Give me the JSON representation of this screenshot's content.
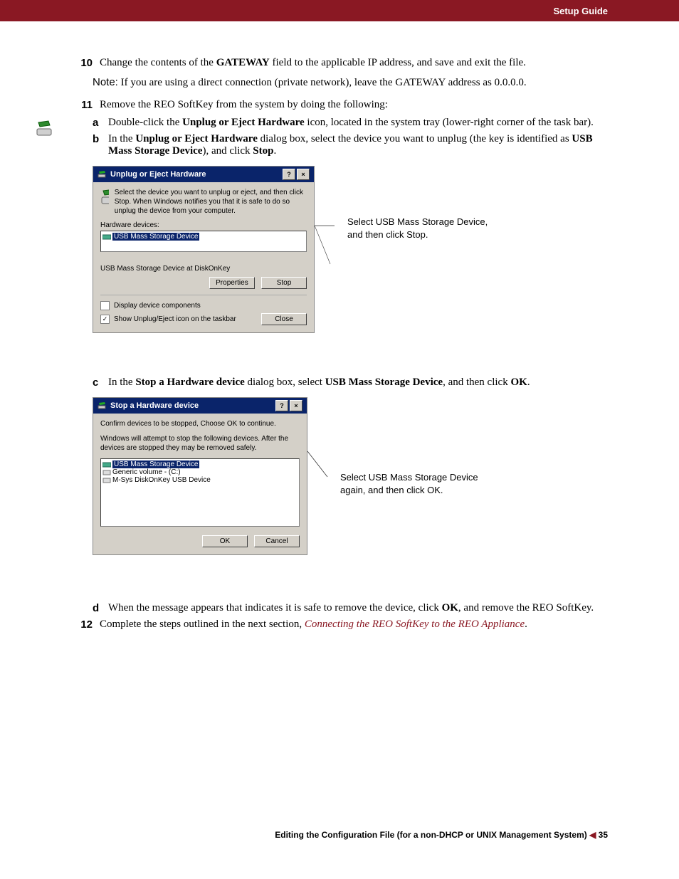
{
  "header": {
    "title": "Setup Guide"
  },
  "steps": {
    "s10": {
      "num": "10",
      "text_pre": "Change the contents of the ",
      "bold1": "GATEWAY",
      "text_post": " field to the applicable IP address, and save and exit the file."
    },
    "note10": {
      "label": "Note:",
      "text": "If you are using a direct connection (private network), leave the GATEWAY address as 0.0.0.0."
    },
    "s11": {
      "num": "11",
      "text": "Remove the REO SoftKey from the system by doing the following:"
    },
    "s11a": {
      "letter": "a",
      "pre": "Double-click the ",
      "bold": "Unplug or Eject Hardware",
      "post": " icon, located in the system tray (lower-right corner of the task bar)."
    },
    "s11b": {
      "letter": "b",
      "pre": "In the ",
      "bold1": "Unplug or Eject Hardware",
      "mid1": " dialog box, select the device you want to unplug (the key is identified as ",
      "bold2": "USB Mass Storage Device",
      "mid2": "), and click ",
      "bold3": "Stop",
      "post": "."
    },
    "s11c": {
      "letter": "c",
      "pre": "In the ",
      "bold1": "Stop a Hardware device",
      "mid1": " dialog box, select ",
      "bold2": "USB Mass Storage Device",
      "mid2": ", and then click ",
      "bold3": "OK",
      "post": "."
    },
    "s11d": {
      "letter": "d",
      "pre": "When the message appears that indicates it is safe to remove the device, click ",
      "bold": "OK",
      "post": ", and remove the REO SoftKey."
    },
    "s12": {
      "num": "12",
      "pre": "Complete the steps outlined in the next section, ",
      "link": "Connecting the REO SoftKey to the REO Appliance",
      "post": "."
    }
  },
  "dlg1": {
    "title": "Unplug or Eject Hardware",
    "info": "Select the device you want to unplug or eject, and then click Stop. When Windows notifies you that it is safe to do so unplug the device from your computer.",
    "label_devices": "Hardware devices:",
    "item_selected": "USB Mass Storage Device",
    "status": "USB Mass Storage Device at DiskOnKey",
    "btn_properties": "Properties",
    "btn_stop": "Stop",
    "chk1": "Display device components",
    "chk2": "Show Unplug/Eject icon on the taskbar",
    "btn_close": "Close"
  },
  "callout1": "Select USB Mass Storage Device, and then click Stop.",
  "dlg2": {
    "title": "Stop a Hardware device",
    "line1": "Confirm devices to be stopped, Choose OK to continue.",
    "line2": "Windows will attempt to stop the following devices. After the devices are stopped they may be removed safely.",
    "item1": "USB Mass Storage Device",
    "item2": "Generic volume - (C:)",
    "item3": "M-Sys DiskOnKey USB Device",
    "btn_ok": "OK",
    "btn_cancel": "Cancel"
  },
  "callout2": "Select USB Mass Storage Device again, and then click OK.",
  "footer": {
    "text": "Editing the Configuration File (for a non-DHCP or UNIX Management System)",
    "page": "35"
  }
}
